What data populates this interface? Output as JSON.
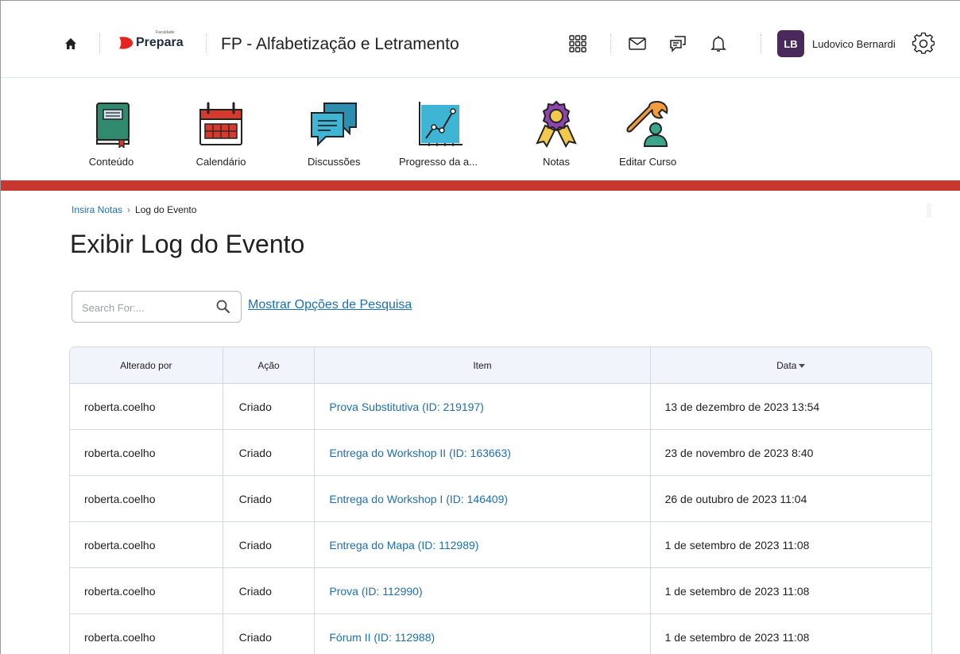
{
  "header": {
    "logo_small": "Faculdade",
    "logo_text": "Prepara",
    "course_title": "FP - Alfabetização e Letramento",
    "user_initials": "LB",
    "user_name": "Ludovico Bernardi"
  },
  "nav": {
    "items": [
      {
        "label": "Conteúdo",
        "icon": "book-icon"
      },
      {
        "label": "Calendário",
        "icon": "calendar-icon"
      },
      {
        "label": "Discussões",
        "icon": "discussions-icon"
      },
      {
        "label": "Progresso da a...",
        "icon": "progress-chart-icon"
      },
      {
        "label": "Notas",
        "icon": "award-ribbon-icon"
      },
      {
        "label": "Editar Curso",
        "icon": "wrench-user-icon"
      }
    ]
  },
  "breadcrumb": {
    "parent": "Insira Notas",
    "current": "Log do Evento"
  },
  "page_title": "Exibir Log do Evento",
  "search": {
    "placeholder": "Search For:...",
    "options_link": "Mostrar Opções de Pesquisa"
  },
  "table": {
    "headers": {
      "changed_by": "Alterado por",
      "action": "Ação",
      "item": "Item",
      "date": "Data"
    },
    "rows": [
      {
        "changed_by": "roberta.coelho",
        "action": "Criado",
        "item": "Prova Substitutiva (ID: 219197)",
        "date": "13 de dezembro de 2023 13:54"
      },
      {
        "changed_by": "roberta.coelho",
        "action": "Criado",
        "item": "Entrega do Workshop II (ID: 163663)",
        "date": "23 de novembro de 2023 8:40"
      },
      {
        "changed_by": "roberta.coelho",
        "action": "Criado",
        "item": "Entrega do Workshop I (ID: 146409)",
        "date": "26 de outubro de 2023 11:04"
      },
      {
        "changed_by": "roberta.coelho",
        "action": "Criado",
        "item": "Entrega do Mapa (ID: 112989)",
        "date": "1 de setembro de 2023 11:08"
      },
      {
        "changed_by": "roberta.coelho",
        "action": "Criado",
        "item": "Prova (ID: 112990)",
        "date": "1 de setembro de 2023 11:08"
      },
      {
        "changed_by": "roberta.coelho",
        "action": "Criado",
        "item": "Fórum II (ID: 112988)",
        "date": "1 de setembro de 2023 11:08"
      }
    ]
  },
  "colors": {
    "accent_red": "#c8372d",
    "link_blue": "#1e6fb0",
    "avatar_bg": "#4a2a5a",
    "table_header_bg": "#f1f5fb"
  }
}
